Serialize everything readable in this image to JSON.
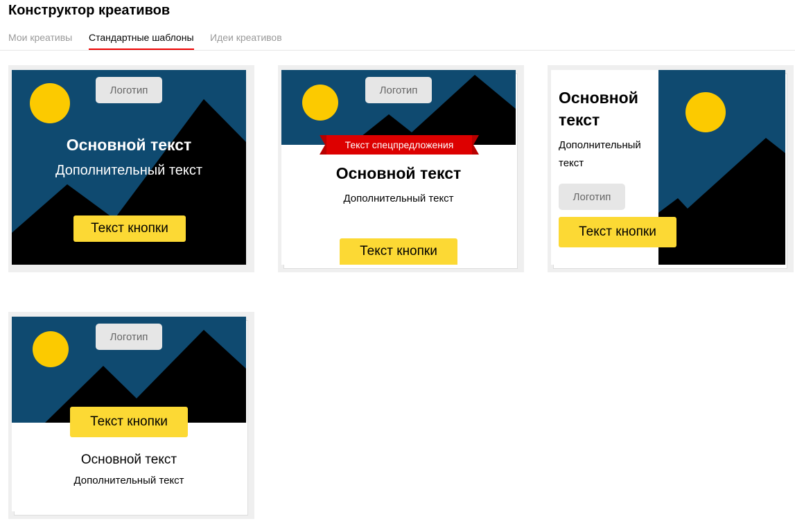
{
  "page": {
    "title": "Конструктор креативов"
  },
  "tabs": [
    {
      "label": "Мои креативы",
      "active": false
    },
    {
      "label": "Стандартные шаблоны",
      "active": true
    },
    {
      "label": "Идеи креативов",
      "active": false
    }
  ],
  "colors": {
    "sky": "#0f4a70",
    "mountain": "#000000",
    "sun": "#fcca00",
    "button": "#fcd934",
    "ribbon": "#dd0000",
    "tab_underline": "#ee0000"
  },
  "templates": [
    {
      "logo": "Логотип",
      "main_text": "Основной текст",
      "extra_text": "Дополнительный текст",
      "button": "Текст кнопки"
    },
    {
      "logo": "Логотип",
      "offer_text": "Текст спецпредложения",
      "main_text": "Основной текст",
      "extra_text": "Дополнительный текст",
      "button": "Текст кнопки"
    },
    {
      "logo": "Логотип",
      "main_text_line1": "Основной",
      "main_text_line2": "текст",
      "extra_text_line1": "Дополнительный",
      "extra_text_line2": "текст",
      "button": "Текст кнопки"
    },
    {
      "logo": "Логотип",
      "main_text": "Основной текст",
      "extra_text": "Дополнительный текст",
      "button": "Текст кнопки"
    }
  ]
}
